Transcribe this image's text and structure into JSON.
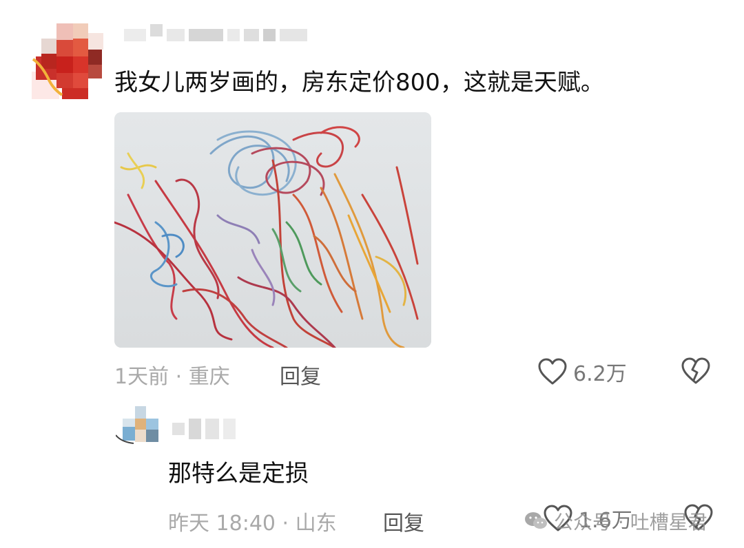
{
  "comment": {
    "username_hidden": true,
    "text": "我女儿两岁画的，房东定价800，这就是天赋。",
    "time": "1天前",
    "separator": "·",
    "location": "重庆",
    "reply_label": "回复",
    "likes": "6.2万",
    "image_icon": "crayon-scribble-drawing"
  },
  "reply": {
    "username_hidden": true,
    "text": "那特么是定损",
    "time": "昨天 18:40",
    "separator": "·",
    "location": "山东",
    "reply_label": "回复",
    "likes": "1.6万"
  },
  "watermark": {
    "text": "公众号 · 吐槽星君",
    "icon": "wechat-icon"
  },
  "colors": {
    "meta": "#a9a9a9",
    "text": "#111111",
    "icon": "#555555"
  }
}
